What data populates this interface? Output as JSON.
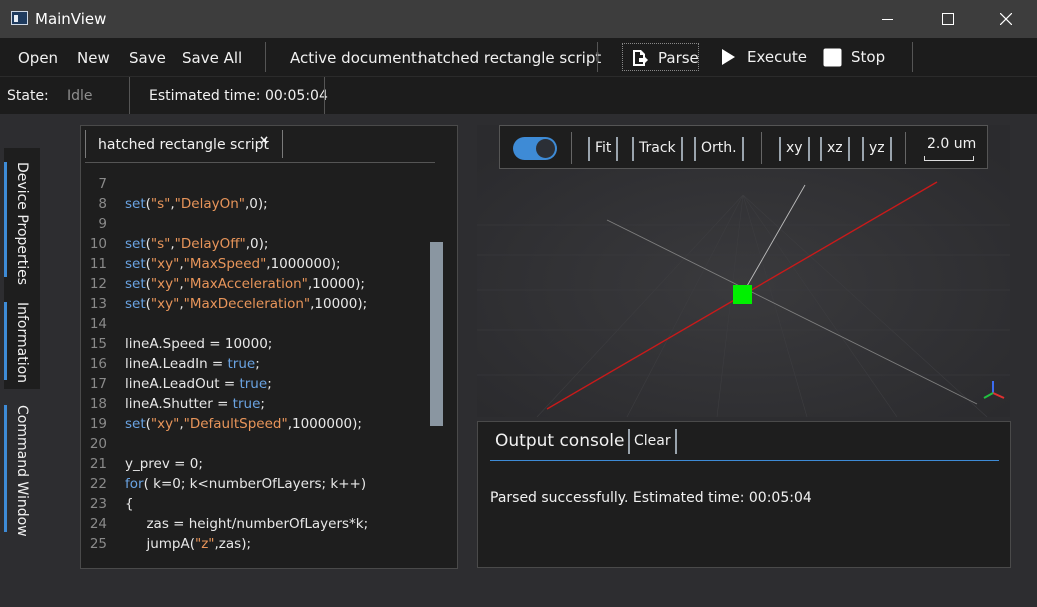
{
  "window": {
    "title": "MainView"
  },
  "toolbar": {
    "open": "Open",
    "new": "New",
    "save": "Save",
    "save_all": "Save All",
    "active_doc_label": "Active document:",
    "active_doc_name": "hatched rectangle script",
    "parse": "Parse",
    "execute": "Execute",
    "stop": "Stop"
  },
  "status": {
    "state_label": "State:",
    "state_value": "Idle",
    "estimated_time": "Estimated time: 00:05:04"
  },
  "side_tabs": [
    "Device Properties",
    "Information",
    "Command Window"
  ],
  "editor": {
    "tab_title": "hatched rectangle script",
    "tab_close": "×",
    "lines": [
      {
        "n": "7",
        "tokens": []
      },
      {
        "n": "8",
        "tokens": [
          {
            "t": "set",
            "k": "kw"
          },
          {
            "t": "(",
            "k": ""
          },
          {
            "t": "\"s\"",
            "k": "str"
          },
          {
            "t": ",",
            "k": ""
          },
          {
            "t": "\"DelayOn\"",
            "k": "str"
          },
          {
            "t": ",0);",
            "k": ""
          }
        ]
      },
      {
        "n": "9",
        "tokens": []
      },
      {
        "n": "10",
        "tokens": [
          {
            "t": "set",
            "k": "kw"
          },
          {
            "t": "(",
            "k": ""
          },
          {
            "t": "\"s\"",
            "k": "str"
          },
          {
            "t": ",",
            "k": ""
          },
          {
            "t": "\"DelayOff\"",
            "k": "str"
          },
          {
            "t": ",0);",
            "k": ""
          }
        ]
      },
      {
        "n": "11",
        "tokens": [
          {
            "t": "set",
            "k": "kw"
          },
          {
            "t": "(",
            "k": ""
          },
          {
            "t": "\"xy\"",
            "k": "str"
          },
          {
            "t": ",",
            "k": ""
          },
          {
            "t": "\"MaxSpeed\"",
            "k": "str"
          },
          {
            "t": ",1000000);",
            "k": ""
          }
        ]
      },
      {
        "n": "12",
        "tokens": [
          {
            "t": "set",
            "k": "kw"
          },
          {
            "t": "(",
            "k": ""
          },
          {
            "t": "\"xy\"",
            "k": "str"
          },
          {
            "t": ",",
            "k": ""
          },
          {
            "t": "\"MaxAcceleration\"",
            "k": "str"
          },
          {
            "t": ",10000);",
            "k": ""
          }
        ]
      },
      {
        "n": "13",
        "tokens": [
          {
            "t": "set",
            "k": "kw"
          },
          {
            "t": "(",
            "k": ""
          },
          {
            "t": "\"xy\"",
            "k": "str"
          },
          {
            "t": ",",
            "k": ""
          },
          {
            "t": "\"MaxDeceleration\"",
            "k": "str"
          },
          {
            "t": ",10000);",
            "k": ""
          }
        ]
      },
      {
        "n": "14",
        "tokens": []
      },
      {
        "n": "15",
        "tokens": [
          {
            "t": "lineA.Speed = 10000;",
            "k": ""
          }
        ]
      },
      {
        "n": "16",
        "tokens": [
          {
            "t": "lineA.LeadIn = ",
            "k": ""
          },
          {
            "t": "true",
            "k": "kw"
          },
          {
            "t": ";",
            "k": ""
          }
        ]
      },
      {
        "n": "17",
        "tokens": [
          {
            "t": "lineA.LeadOut = ",
            "k": ""
          },
          {
            "t": "true",
            "k": "kw"
          },
          {
            "t": ";",
            "k": ""
          }
        ]
      },
      {
        "n": "18",
        "tokens": [
          {
            "t": "lineA.Shutter = ",
            "k": ""
          },
          {
            "t": "true",
            "k": "kw"
          },
          {
            "t": ";",
            "k": ""
          }
        ]
      },
      {
        "n": "19",
        "tokens": [
          {
            "t": "set",
            "k": "kw"
          },
          {
            "t": "(",
            "k": ""
          },
          {
            "t": "\"xy\"",
            "k": "str"
          },
          {
            "t": ",",
            "k": ""
          },
          {
            "t": "\"DefaultSpeed\"",
            "k": "str"
          },
          {
            "t": ",1000000);",
            "k": ""
          }
        ]
      },
      {
        "n": "20",
        "tokens": []
      },
      {
        "n": "21",
        "tokens": [
          {
            "t": "y_prev = 0;",
            "k": ""
          }
        ]
      },
      {
        "n": "22",
        "tokens": [
          {
            "t": "for",
            "k": "kw"
          },
          {
            "t": "( k=0; k<numberOfLayers; k++)",
            "k": ""
          }
        ]
      },
      {
        "n": "23",
        "tokens": [
          {
            "t": "{",
            "k": ""
          }
        ]
      },
      {
        "n": "24",
        "tokens": [
          {
            "t": "     zas = height/numberOfLayers*k;",
            "k": ""
          }
        ]
      },
      {
        "n": "25",
        "tokens": [
          {
            "t": "     jumpA(",
            "k": ""
          },
          {
            "t": "\"z\"",
            "k": "str"
          },
          {
            "t": ",zas);",
            "k": ""
          }
        ]
      }
    ]
  },
  "view_toolbar": {
    "fit": "Fit",
    "track": "Track",
    "ortho": "Orth.",
    "xy": "xy",
    "xz": "xz",
    "yz": "yz",
    "scale": "2.0 um",
    "toggle_on": true
  },
  "console": {
    "title": "Output console",
    "clear": "Clear",
    "message": "Parsed successfully. Estimated time: 00:05:04"
  },
  "colors": {
    "accent": "#3e8bd6",
    "keyword": "#6aa3e2",
    "string": "#e8955a",
    "x_axis": "#d01818",
    "marker": "#00f000"
  }
}
